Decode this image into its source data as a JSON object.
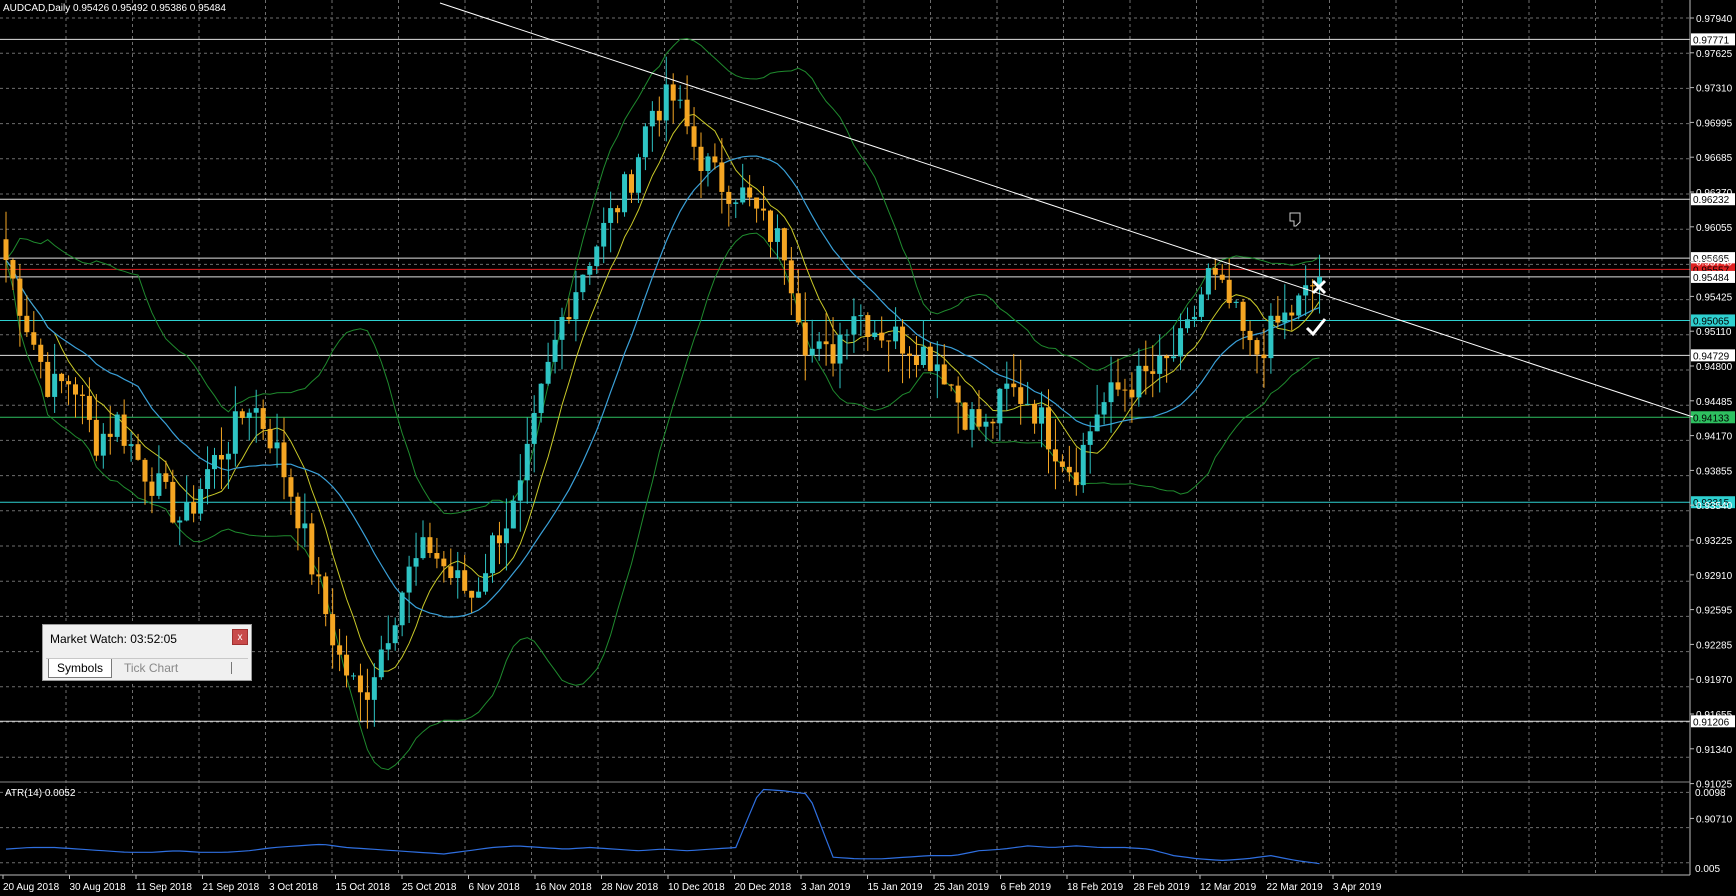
{
  "window": {
    "symbol_info": "AUDCAD,Daily  0.95426 0.95492 0.95386 0.95484"
  },
  "colors": {
    "background": "#000000",
    "grid": "#6e6e6e",
    "bull_candle": "#2ec4c4",
    "bear_candle": "#f5a623",
    "trendline": "#ffffff",
    "bollinger": "#1f8a2e",
    "ma_fast": "#c9c928",
    "ma_slow": "#3aa0d8",
    "atr_line": "#2f6fe0",
    "hline_white": "#e0e0e0",
    "hline_red": "#e02020",
    "hline_cyan": "#2ed0d0",
    "hline_green": "#2ec060"
  },
  "price_axis": {
    "range": [
      0.9066,
      0.9815
    ],
    "labels": [
      "0.97940",
      "0.97625",
      "0.97310",
      "0.96995",
      "0.96685",
      "0.96370",
      "0.96055",
      "0.95740",
      "0.95425",
      "0.95110",
      "0.94800",
      "0.94485",
      "0.94170",
      "0.93855",
      "0.93540",
      "0.93225",
      "0.92910",
      "0.92595",
      "0.92285",
      "0.91970",
      "0.91655",
      "0.91340",
      "0.91025",
      "0.90710"
    ],
    "highlight_levels": [
      {
        "price": 0.97771,
        "label": "0.97771",
        "kind": "white"
      },
      {
        "price": 0.96232,
        "label": "0.96232",
        "kind": "white"
      },
      {
        "price": 0.95665,
        "label": "0.95665",
        "kind": "white"
      },
      {
        "price": 0.95557,
        "label": "0.95557",
        "kind": "red"
      },
      {
        "price": 0.95484,
        "label": "0.95484",
        "kind": "white"
      },
      {
        "price": 0.95065,
        "label": "0.95065",
        "kind": "cyan"
      },
      {
        "price": 0.94729,
        "label": "0.94729",
        "kind": "white"
      },
      {
        "price": 0.94133,
        "label": "0.94133",
        "kind": "green"
      },
      {
        "price": 0.93315,
        "label": "0.93315",
        "kind": "cyan"
      },
      {
        "price": 0.91206,
        "label": "0.91206",
        "kind": "white"
      }
    ]
  },
  "time_axis": {
    "labels": [
      "20 Aug 2018",
      "30 Aug 2018",
      "11 Sep 2018",
      "21 Sep 2018",
      "3 Oct 2018",
      "15 Oct 2018",
      "25 Oct 2018",
      "6 Nov 2018",
      "16 Nov 2018",
      "28 Nov 2018",
      "10 Dec 2018",
      "20 Dec 2018",
      "3 Jan 2019",
      "15 Jan 2019",
      "25 Jan 2019",
      "6 Feb 2019",
      "18 Feb 2019",
      "28 Feb 2019",
      "12 Mar 2019",
      "22 Mar 2019",
      "3 Apr 2019"
    ]
  },
  "atr": {
    "label": "ATR(14) 0.0052",
    "axis_top": "0.0098",
    "axis_bottom": "0.005",
    "range": [
      0.0045,
      0.01
    ]
  },
  "chart_data": {
    "type": "candlestick",
    "close_anchors": [
      0.9565,
      0.95,
      0.944,
      0.945,
      0.939,
      0.941,
      0.937,
      0.934,
      0.931,
      0.936,
      0.939,
      0.943,
      0.939,
      0.933,
      0.925,
      0.918,
      0.914,
      0.92,
      0.926,
      0.929,
      0.926,
      0.924,
      0.93,
      0.933,
      0.943,
      0.951,
      0.956,
      0.96,
      0.964,
      0.971,
      0.972,
      0.967,
      0.964,
      0.963,
      0.96,
      0.9575,
      0.948,
      0.947,
      0.952,
      0.95,
      0.949,
      0.948,
      0.9465,
      0.942,
      0.94,
      0.944,
      0.943,
      0.939,
      0.936,
      0.942,
      0.944,
      0.945,
      0.946,
      0.949,
      0.955,
      0.952,
      0.947,
      0.95,
      0.952,
      0.9548
    ],
    "atr_anchors": [
      0.0061,
      0.0062,
      0.0062,
      0.0061,
      0.006,
      0.0059,
      0.0059,
      0.006,
      0.0059,
      0.0059,
      0.006,
      0.0062,
      0.0063,
      0.0064,
      0.0062,
      0.0061,
      0.006,
      0.0059,
      0.0058,
      0.006,
      0.0062,
      0.0063,
      0.0062,
      0.0061,
      0.0062,
      0.0061,
      0.006,
      0.0061,
      0.006,
      0.0061,
      0.0062,
      0.0098,
      0.0097,
      0.0095,
      0.0056,
      0.0055,
      0.0055,
      0.0056,
      0.0057,
      0.0057,
      0.006,
      0.0061,
      0.0063,
      0.0062,
      0.0063,
      0.0062,
      0.0062,
      0.0061,
      0.0057,
      0.0055,
      0.0054,
      0.0055,
      0.0057,
      0.0054,
      0.0052
    ]
  },
  "market_watch": {
    "title": "Market Watch: 03:52:05",
    "close_label": "x",
    "tabs": [
      {
        "label": "Symbols",
        "active": true
      },
      {
        "label": "Tick Chart",
        "active": false
      }
    ]
  }
}
